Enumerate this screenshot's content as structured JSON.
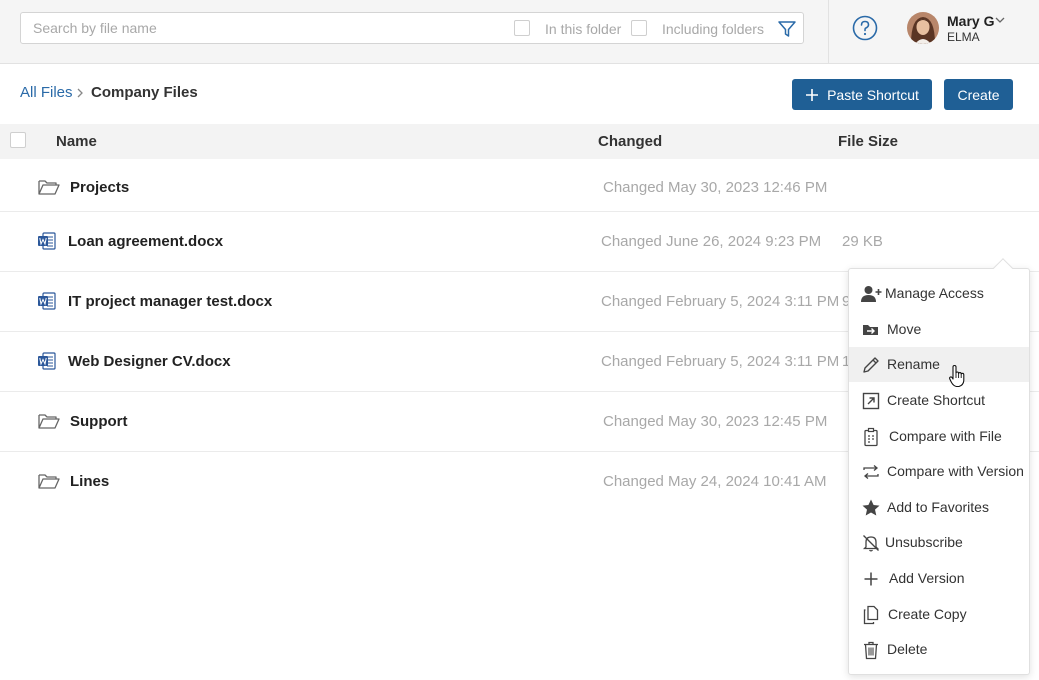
{
  "search": {
    "placeholder": "Search by file name",
    "value": "",
    "in_this_folder": "In this folder",
    "including_folders": "Including folders"
  },
  "user": {
    "name": "Mary G",
    "org": "ELMA"
  },
  "breadcrumb": {
    "root": "All Files",
    "current": "Company Files"
  },
  "actions": {
    "paste_shortcut": "Paste Shortcut",
    "create": "Create"
  },
  "table": {
    "headers": {
      "name": "Name",
      "changed": "Changed",
      "size": "File Size"
    },
    "rows": [
      {
        "type": "folder",
        "name": "Projects",
        "changed": "Changed May 30, 2023 12:46 PM",
        "size": ""
      },
      {
        "type": "word",
        "name": "Loan agreement.docx",
        "changed": "Changed June 26, 2024 9:23 PM",
        "size": "29 KB"
      },
      {
        "type": "word",
        "name": "IT project manager test.docx",
        "changed": "Changed February 5, 2024 3:11 PM",
        "size": "9"
      },
      {
        "type": "word",
        "name": "Web Designer CV.docx",
        "changed": "Changed February 5, 2024 3:11 PM",
        "size": "1"
      },
      {
        "type": "folder",
        "name": "Support",
        "changed": "Changed May 30, 2023 12:45 PM",
        "size": ""
      },
      {
        "type": "folder",
        "name": "Lines",
        "changed": "Changed May 24, 2024 10:41 AM",
        "size": ""
      }
    ]
  },
  "context_menu": {
    "items": [
      {
        "label": "Manage Access",
        "icon": "user-plus-icon"
      },
      {
        "label": "Move",
        "icon": "move-folder-icon"
      },
      {
        "label": "Rename",
        "icon": "pencil-icon"
      },
      {
        "label": "Create Shortcut",
        "icon": "shortcut-icon"
      },
      {
        "label": "Compare with File",
        "icon": "compare-file-icon"
      },
      {
        "label": "Compare with Version",
        "icon": "compare-version-icon"
      },
      {
        "label": "Add to Favorites",
        "icon": "star-icon"
      },
      {
        "label": "Unsubscribe",
        "icon": "bell-off-icon"
      },
      {
        "label": "Add Version",
        "icon": "plus-icon"
      },
      {
        "label": "Create Copy",
        "icon": "copy-icon"
      },
      {
        "label": "Delete",
        "icon": "trash-icon"
      }
    ]
  },
  "colors": {
    "primary": "#1f5f95",
    "link": "#2a6aa8",
    "word": "#2b579a"
  }
}
